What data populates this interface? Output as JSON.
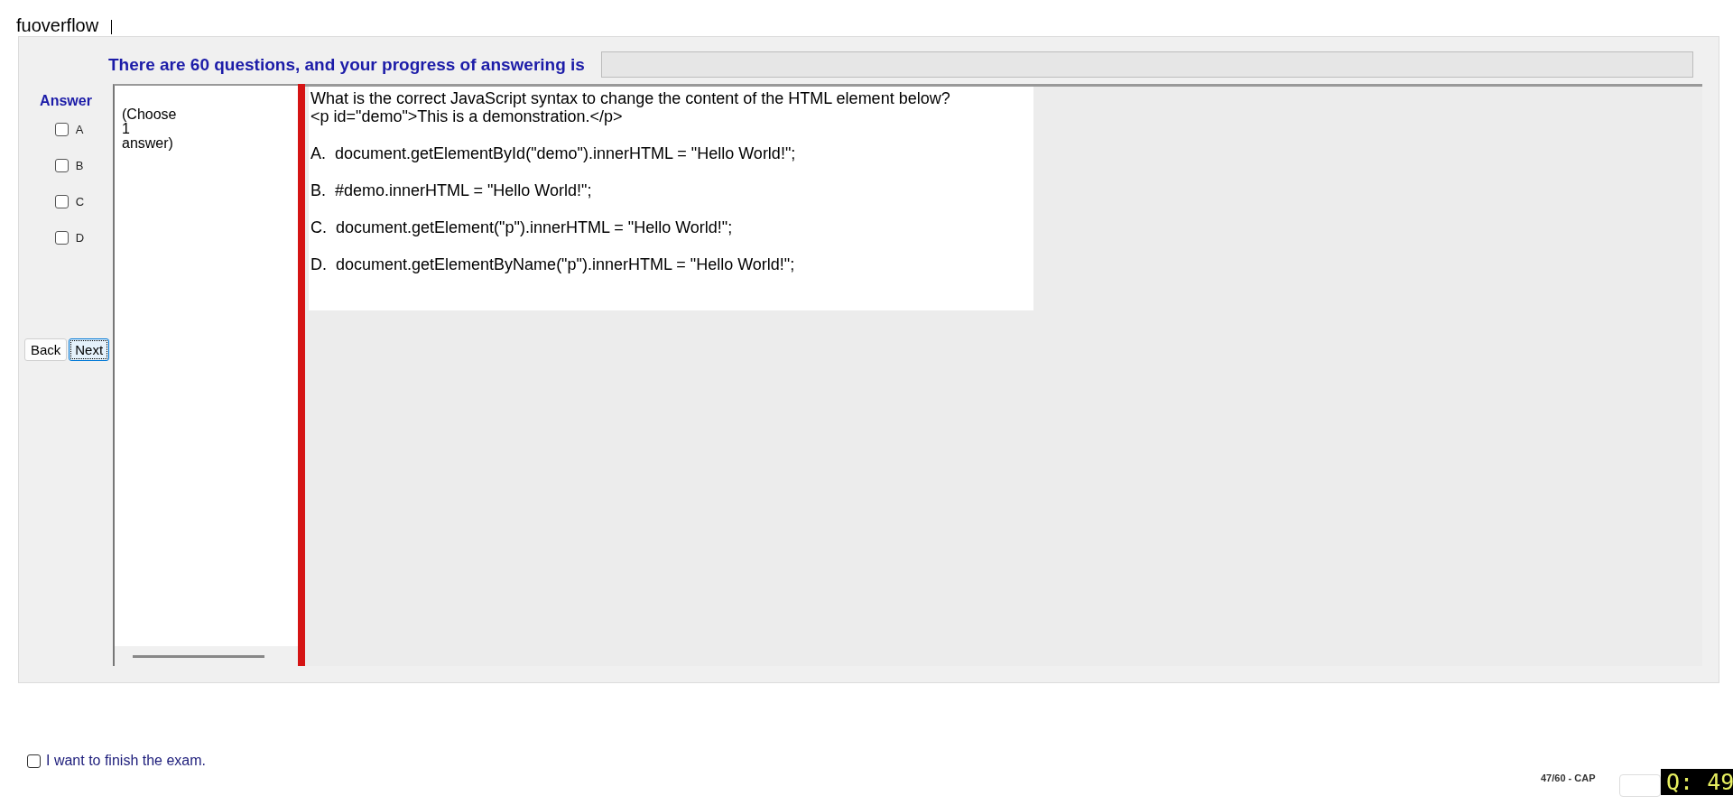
{
  "app_title": "fuoverflow",
  "progress": {
    "label": "There are 60 questions, and your progress of answering is",
    "level": 0
  },
  "answer_panel": {
    "title": "Answer",
    "options": [
      {
        "label": "A",
        "checked": false
      },
      {
        "label": "B",
        "checked": false
      },
      {
        "label": "C",
        "checked": false
      },
      {
        "label": "D",
        "checked": false
      }
    ]
  },
  "buttons": [
    {
      "label": "Back",
      "focused": false
    },
    {
      "label": "Next",
      "focused": true
    }
  ],
  "hint": "(Choose\n1\nanswer)",
  "question": {
    "lines": [
      "What is the correct JavaScript syntax to change the content of the HTML element below?",
      "<p id=\"demo\">This is a demonstration.</p>"
    ],
    "choices": [
      "A.  document.getElementById(\"demo\").innerHTML = \"Hello World!\";",
      "B.  #demo.innerHTML = \"Hello World!\";",
      "C.  document.getElement(\"p\").innerHTML = \"Hello World!\";",
      "D.  document.getElementByName(\"p\").innerHTML = \"Hello World!\";"
    ]
  },
  "finish": {
    "label": "I want to finish the exam.",
    "checked": false
  },
  "status": "47/60 - CAP",
  "question_badge": "Q: 49"
}
